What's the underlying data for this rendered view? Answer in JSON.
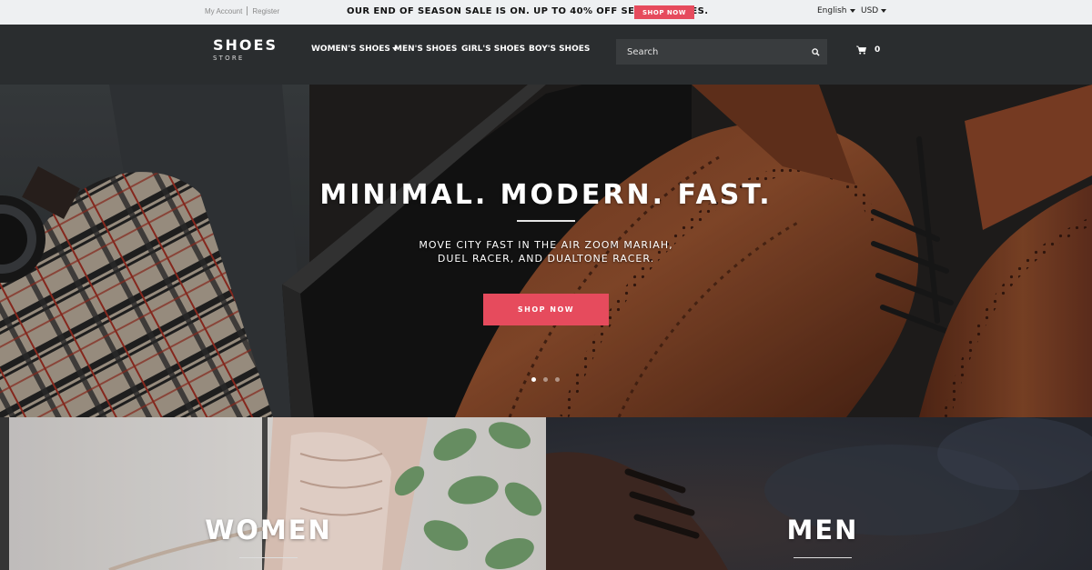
{
  "topbar": {
    "my_account": "My Account",
    "register": "Register",
    "promo_text": "OUR END OF SEASON SALE IS ON. UP TO 40% OFF SELECT STYLES.",
    "promo_button": "SHOP NOW",
    "language": "English",
    "currency": "USD"
  },
  "header": {
    "logo_main": "SHOES",
    "logo_sub": "STORE",
    "nav": [
      {
        "label": "WOMEN'S SHOES",
        "has_dropdown": true
      },
      {
        "label": "MEN'S SHOES"
      },
      {
        "label": "GIRL'S SHOES"
      },
      {
        "label": "BOY'S SHOES"
      }
    ],
    "search_placeholder": "Search",
    "cart_count": "0"
  },
  "hero": {
    "title": "MINIMAL. MODERN. FAST.",
    "subtitle_line1": "MOVE CITY FAST IN THE AIR ZOOM MARIAH,",
    "subtitle_line2": "DUEL RACER, AND DUALTONE RACER.",
    "button": "SHOP NOW",
    "slides": 3,
    "active_slide": 1
  },
  "categories": [
    {
      "label": "WOMEN"
    },
    {
      "label": "MEN"
    }
  ],
  "colors": {
    "accent": "#e64b5d",
    "header_bg": "#2a2d2f",
    "topbar_bg": "#eef0f2",
    "search_bg": "#393c3e"
  },
  "icons": {
    "search": "search-icon",
    "cart": "cart-icon",
    "dropdown": "chevron-down-icon"
  }
}
